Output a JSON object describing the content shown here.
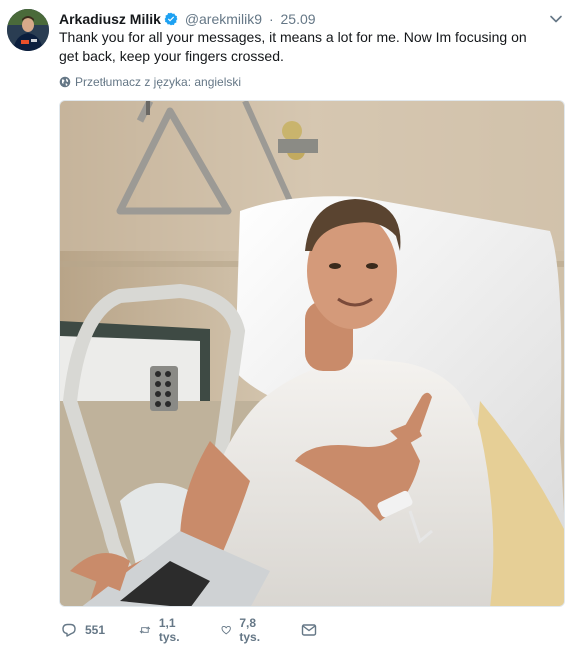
{
  "tweet": {
    "author_name": "Arkadiusz Milik",
    "handle": "@arekmilik9",
    "separator": "·",
    "date": "25.09",
    "text": "Thank you for all your messages, it means a lot for me. Now Im focusing on get back, keep your fingers crossed.",
    "translate_label": "Przetłumacz z języka: angielski",
    "verified": true
  },
  "actions": {
    "replies": "551",
    "retweets": "1,1 tys.",
    "likes": "7,8 tys."
  },
  "colors": {
    "verified_blue": "#1da1f2",
    "muted": "#657786",
    "text": "#14171a"
  },
  "icons": [
    "verified-badge-icon",
    "chevron-down-icon",
    "globe-icon",
    "reply-icon",
    "retweet-icon",
    "like-heart-icon",
    "direct-message-icon"
  ]
}
